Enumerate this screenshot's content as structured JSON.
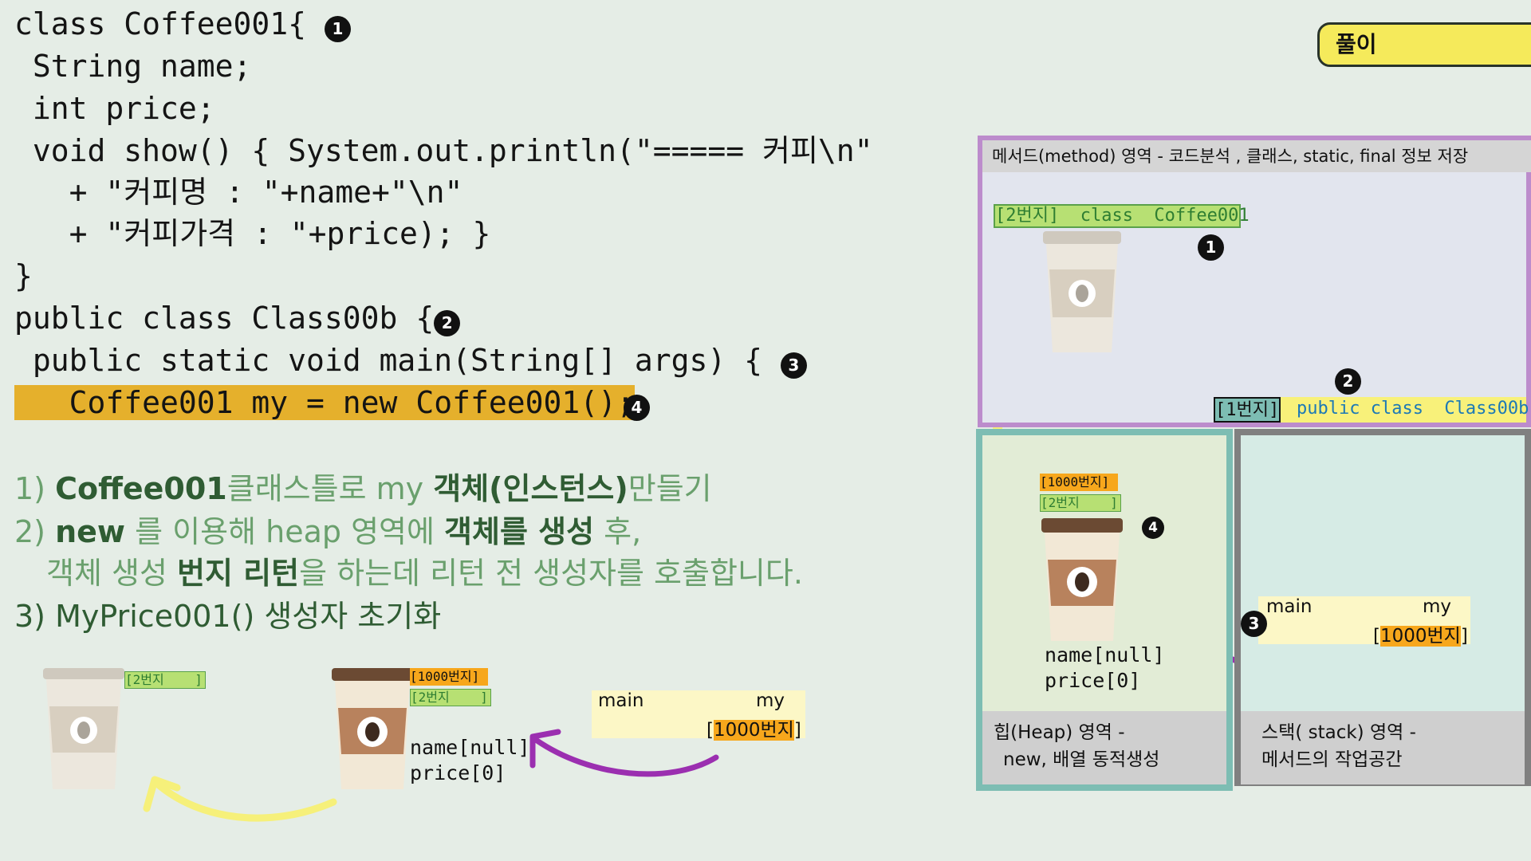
{
  "code": {
    "lines": [
      "class Coffee001{",
      " String name;",
      " int price;",
      " void show() { System.out.println(\"===== 커피\\n\"",
      "   + \"커피명 : \"+name+\"\\n\"",
      "   + \"커피가격 : \"+price); }",
      "}",
      "public class Class00b {",
      " public static void main(String[] args) {",
      "   Coffee001 my = new Coffee001();"
    ],
    "markers": [
      "1",
      "2",
      "3",
      "4"
    ]
  },
  "explanation": {
    "line1": {
      "num": "1)",
      "a": "Coffee001",
      "b": "클래스틀로 my ",
      "c": "객체(인스턴스)",
      "d": "만들기"
    },
    "line2": {
      "num": "2)",
      "a": "new",
      "b": " 를 이용해 heap 영역에 ",
      "c": "객체를 생성",
      "d": " 후,"
    },
    "line3": {
      "a": "객체 생성 ",
      "b": "번지 리턴",
      "c": "을 하는데 리턴 전 생성자를 호출합니다."
    },
    "line4": {
      "num": "3)",
      "text": "MyPrice001() 생성자 초기화"
    }
  },
  "badge": {
    "label": "풀이"
  },
  "left_illustration": {
    "cup1_tag": "[2번지    ]",
    "cup2_tag1": "[1000번지]",
    "cup2_tag2": "[2번지    ]",
    "fields": [
      "name[null]",
      "price[0]"
    ],
    "var_main": "main",
    "var_my": "my",
    "var_addr": "1000번지"
  },
  "diagram": {
    "method_area": {
      "header": "메서드(method) 영역  - 코드분석 , 클래스, static, final 정보 저장",
      "class_addr": "[2번지]",
      "class_label": "class  Coffee001",
      "marker1": "1",
      "marker2": "2",
      "main_addr": "[1번지]",
      "main_label": "public class  Class00b"
    },
    "heap_area": {
      "tag1": "[1000번지]",
      "tag2": "[2번지    ]",
      "marker": "4",
      "fields": [
        "name[null]",
        "price[0]"
      ],
      "footer_line1": "힙(Heap) 영역 -",
      "footer_line2": "new, 배열 동적생성"
    },
    "stack_area": {
      "marker": "3",
      "var_main": "main",
      "var_my": "my",
      "var_addr": "1000번지",
      "footer_line1": "스택( stack) 영역 -",
      "footer_line2": "메서드의 작업공간"
    }
  },
  "colors": {
    "highlight": "#e5b02c",
    "text_green": "#6aa06d",
    "text_darkgreen": "#2f5c33",
    "method_border": "#bc8ccc",
    "heap_border": "#7dbdb3",
    "stack_border": "#808080",
    "arrow_yellow": "#f6f07a",
    "arrow_purple": "#9b2fb0",
    "badge_bg": "#f5ea5b"
  }
}
